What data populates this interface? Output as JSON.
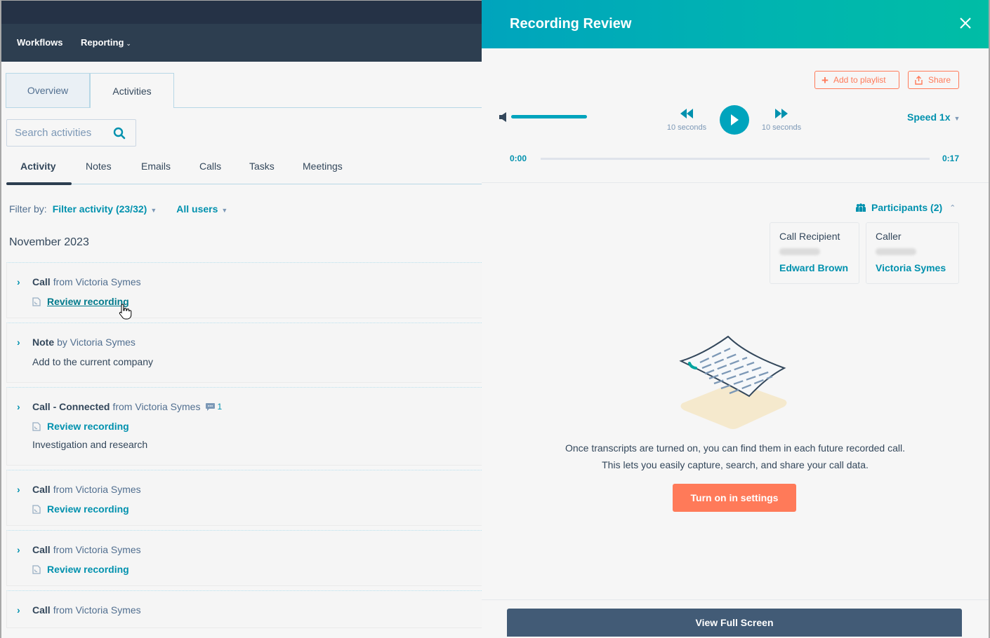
{
  "nav": {
    "items": [
      {
        "label": "Workflows"
      },
      {
        "label": "Reporting",
        "has_dropdown": true
      }
    ]
  },
  "main_tabs": [
    {
      "label": "Overview",
      "active": false
    },
    {
      "label": "Activities",
      "active": true
    }
  ],
  "search": {
    "placeholder": "Search activities",
    "value": ""
  },
  "sub_tabs": [
    {
      "label": "Activity",
      "active": true
    },
    {
      "label": "Notes"
    },
    {
      "label": "Emails"
    },
    {
      "label": "Calls"
    },
    {
      "label": "Tasks"
    },
    {
      "label": "Meetings"
    }
  ],
  "filter": {
    "label": "Filter by:",
    "activity": "Filter activity (23/32)",
    "users": "All users"
  },
  "month": "November 2023",
  "activities": [
    {
      "type": "Call",
      "from": "from Victoria Symes",
      "link": "Review recording",
      "body": ""
    },
    {
      "type": "Note",
      "from": "by Victoria Symes",
      "link": "",
      "body": "Add to the current company"
    },
    {
      "type": "Call - Connected",
      "from": "from Victoria Symes",
      "comment_count": "1",
      "link": "Review recording",
      "body": "Investigation and research"
    },
    {
      "type": "Call",
      "from": "from Victoria Symes",
      "link": "Review recording",
      "body": ""
    },
    {
      "type": "Call",
      "from": "from Victoria Symes",
      "link": "Review recording",
      "body": ""
    },
    {
      "type": "Call",
      "from": "from Victoria Symes",
      "link": "",
      "body": ""
    }
  ],
  "panel": {
    "title": "Recording Review",
    "add_to_playlist": "Add to playlist",
    "share": "Share",
    "skip_back_label": "10 seconds",
    "skip_forward_label": "10 seconds",
    "speed": "Speed 1x",
    "time_start": "0:00",
    "time_end": "0:17",
    "volume_level": 1.0,
    "playback_progress": 0.0,
    "participants_label": "Participants (2)",
    "participants": [
      {
        "role": "Call Recipient",
        "name": "Edward Brown"
      },
      {
        "role": "Caller",
        "name": "Victoria Symes"
      }
    ],
    "info_line1": "Once transcripts are turned on, you can find them in each future recorded call.",
    "info_line2": "This lets you easily capture, search, and share your call data.",
    "turn_on_button": "Turn on in settings",
    "view_full_screen": "View Full Screen"
  },
  "colors": {
    "accent": "#0091ae",
    "header_gradient_start": "#00a4bd",
    "header_gradient_end": "#00bda5",
    "cta": "#ff7a59",
    "nav_bg": "#2d3e50",
    "full_screen_bg": "#425b76"
  }
}
